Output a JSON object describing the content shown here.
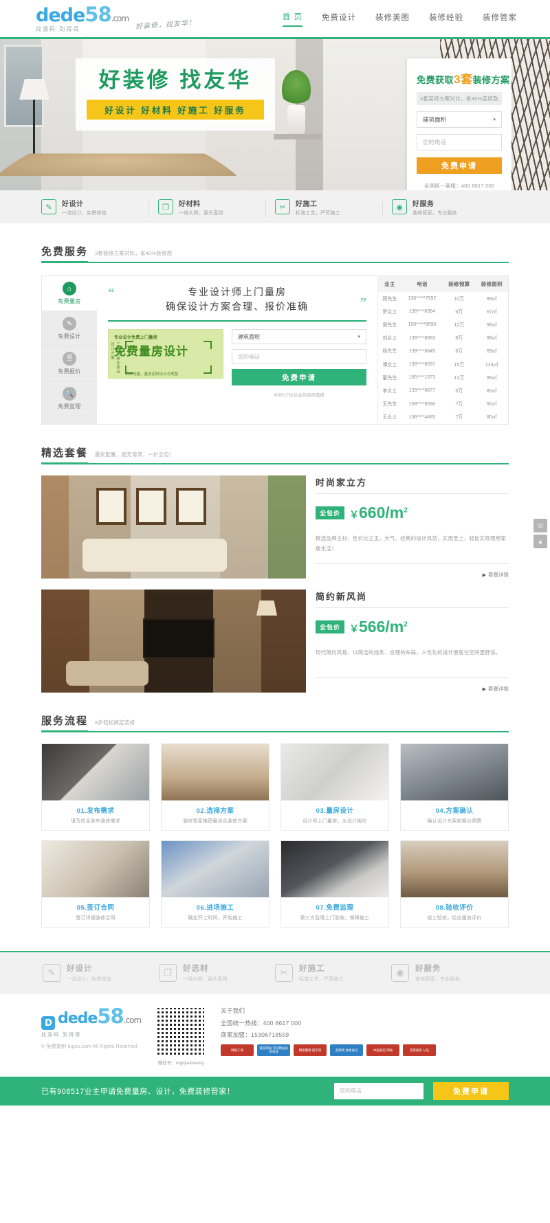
{
  "header": {
    "logo": {
      "main": "dede",
      "num": "58",
      "com": ".com",
      "sub": "找源码 到得得",
      "slogan": "好装修，找友华！"
    },
    "nav": [
      {
        "label": "首 页",
        "active": true
      },
      {
        "label": "免费设计",
        "active": false
      },
      {
        "label": "装修美图",
        "active": false
      },
      {
        "label": "装修经验",
        "active": false
      },
      {
        "label": "装修管家",
        "active": false
      }
    ]
  },
  "hero": {
    "title": "好装修 找友华",
    "tags": "好设计  好材料  好施工  好服务",
    "form": {
      "title_pre": "免费获取",
      "title_num": "3套",
      "title_post": "装修方案",
      "sub": "3套装修方案对比，省40%装修款",
      "area_value": "建筑面积",
      "phone_placeholder": "您的电话",
      "submit": "免费申请",
      "hotline": "全国统一客服：400 8617 000"
    }
  },
  "features": [
    {
      "icon": "pencil-icon",
      "glyph": "✎",
      "title": "好设计",
      "desc": "一流设计，实景体验"
    },
    {
      "icon": "layers-icon",
      "glyph": "❐",
      "title": "好材料",
      "desc": "一线大牌，源头直供"
    },
    {
      "icon": "brush-icon",
      "glyph": "✂",
      "title": "好施工",
      "desc": "标准工艺，严苛施工"
    },
    {
      "icon": "circles-icon",
      "glyph": "◉",
      "title": "好服务",
      "desc": "装修管家，专业服务"
    }
  ],
  "free_service": {
    "section_title": "免费服务",
    "section_sub": "3套装修方案对比，省40%装修款",
    "tabs": [
      {
        "label": "免费量房",
        "icon": "home-check-icon",
        "glyph": "⌂",
        "active": true
      },
      {
        "label": "免费设计",
        "icon": "pen-icon",
        "glyph": "✎",
        "active": false
      },
      {
        "label": "免费报价",
        "icon": "clipboard-icon",
        "glyph": "🗎",
        "active": false
      },
      {
        "label": "免费监理",
        "icon": "magnifier-icon",
        "glyph": "🔍",
        "active": false
      }
    ],
    "quote_line1": "专业设计师上门量房",
    "quote_line2": "确保设计方案合理、报价准确",
    "poster": {
      "tag": "专业设计免费上门量房",
      "big": "免费量房设计",
      "side": "三's'方案免费出设计方案",
      "note": "精准测量，量身定制设计方案图"
    },
    "form": {
      "area_value": "建筑面积",
      "phone_placeholder": "您的电话",
      "submit": "免费申请",
      "note": "908517位业主的共同选择"
    },
    "table": {
      "headers": [
        "业主",
        "电话",
        "装修预算",
        "装修面积"
      ],
      "rows": [
        [
          "顾先生",
          "136*****7592",
          "11万",
          "99㎡"
        ],
        [
          "罗女士",
          "136****6354",
          "6万",
          "67㎡"
        ],
        [
          "窦先生",
          "158*****8590",
          "12万",
          "96㎡"
        ],
        [
          "刘女士",
          "136****8963",
          "8万",
          "88㎡"
        ],
        [
          "杨先生",
          "138****6645",
          "6万",
          "69㎡"
        ],
        [
          "谭女士",
          "136****8597",
          "15万",
          "124㎡"
        ],
        [
          "董先生",
          "185****1573",
          "12万",
          "95㎡"
        ],
        [
          "李女士",
          "135****6677",
          "5万",
          "80㎡"
        ],
        [
          "王先生",
          "158****8596",
          "7万",
          "92㎡"
        ],
        [
          "王女士",
          "136****4485",
          "7万",
          "80㎡"
        ]
      ]
    }
  },
  "packages": {
    "section_title": "精选套餐",
    "section_sub": "最优配置，绝无增项，一价全包！",
    "items": [
      {
        "name": "时尚家立方",
        "badge": "全包价",
        "currency": "￥",
        "price": "660/m",
        "unit": "2",
        "desc": "精选品牌主材，性价比之王，大气、经典的设计风范，实用至上，轻松实现理想家居生活！",
        "more": "套餐详情",
        "img_class": "a"
      },
      {
        "name": "简约新风尚",
        "badge": "全包价",
        "currency": "￥",
        "price": "566/m",
        "unit": "2",
        "desc": "现代简约风格，以简洁的线条、合理的布局，人性化的设计使居住空间更舒适。",
        "more": "套餐详情",
        "img_class": "b"
      }
    ]
  },
  "process": {
    "section_title": "服务流程",
    "section_sub": "8步轻松搞定装修",
    "steps": [
      {
        "title": "01.发布需求",
        "desc": "填写信息发布装修需求",
        "img": "p1"
      },
      {
        "title": "02.选择方案",
        "desc": "装修管家推荐最适合装修方案",
        "img": "p2"
      },
      {
        "title": "03.量房设计",
        "desc": "设计师上门量房，出设计报价",
        "img": "p3"
      },
      {
        "title": "04.方案确认",
        "desc": "确认设计方案和报价预算",
        "img": "p4"
      },
      {
        "title": "05.签订合同",
        "desc": "签订详细装修合同",
        "img": "p5"
      },
      {
        "title": "06.进场施工",
        "desc": "确定开工时间，开始施工",
        "img": "p6"
      },
      {
        "title": "07.免费监理",
        "desc": "第三方监理上门验收，保障施工",
        "img": "p7"
      },
      {
        "title": "08.验收评价",
        "desc": "竣工验收，给出服务评价",
        "img": "p8"
      }
    ]
  },
  "footer_features": [
    {
      "icon": "pencil-icon",
      "glyph": "✎",
      "title": "好设计",
      "desc": "一流设计，实景体验"
    },
    {
      "icon": "layers-icon",
      "glyph": "❐",
      "title": "好选材",
      "desc": "一线大牌，源头直供"
    },
    {
      "icon": "brush-icon",
      "glyph": "✂",
      "title": "好施工",
      "desc": "标准工艺，严苛施工"
    },
    {
      "icon": "circles-icon",
      "glyph": "◉",
      "title": "好服务",
      "desc": "装修管家，专业服务"
    }
  ],
  "footer": {
    "logo_badge": "D",
    "logo_main": "dede",
    "logo_num": "58",
    "logo_com": ".com",
    "logo_sub": "找源码 到得得",
    "copyright": "© 免费复制 tugou.com All Rights Reserved",
    "qr_caption": "微信号：togojiazhuang",
    "about_title": "关于我们",
    "links": [
      "全国统一热线：400 8617 000",
      "商家加盟：15306718559"
    ],
    "certs": [
      {
        "label": "网络工商",
        "color": "#c0392b"
      },
      {
        "label": "诚信网站\n可信网站身份验证",
        "color": "#2f7fc4"
      },
      {
        "label": "网络警察\n提示您",
        "color": "#c0392b"
      },
      {
        "label": "互联网\n协会会员",
        "color": "#2f7fc4"
      },
      {
        "label": "中国诚信\n网站",
        "color": "#c0392b"
      },
      {
        "label": "百家服务\n认证",
        "color": "#c0392b"
      }
    ]
  },
  "bottombar": {
    "text": "已有908517业主申请免费量房、设计，免费装修管家！",
    "input_placeholder": "您的电话",
    "button": "免费申请"
  },
  "side_buttons": [
    {
      "icon": "qq-icon",
      "glyph": "☏"
    },
    {
      "icon": "top-icon",
      "glyph": "▲"
    }
  ],
  "colors": {
    "brand_green": "#2fb37a",
    "accent_orange": "#f0a020",
    "accent_yellow": "#f5c518",
    "link_blue": "#3ba9e0"
  }
}
